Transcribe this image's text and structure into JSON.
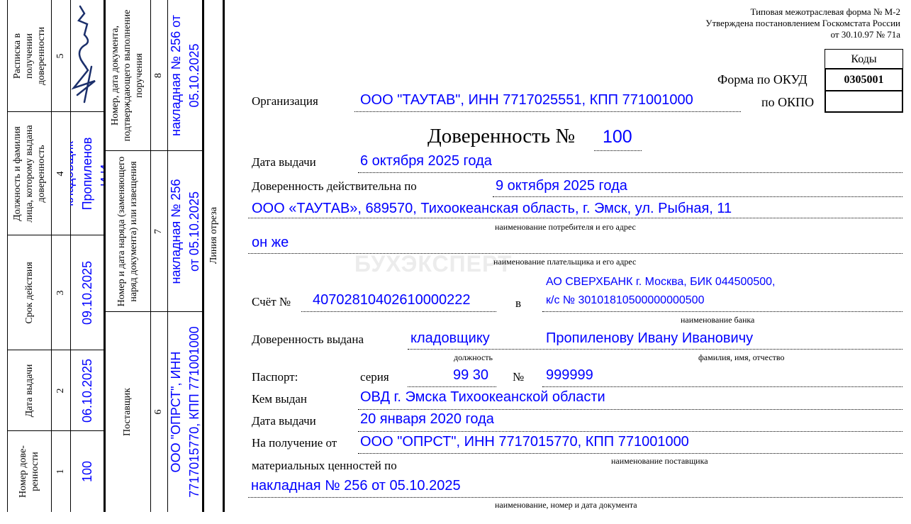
{
  "stub": {
    "col1": {
      "header": "Номер дове-ренности",
      "num": "1",
      "value": "100"
    },
    "col2": {
      "header": "Дата выдачи",
      "num": "2",
      "value": "06.10.2025"
    },
    "col3": {
      "header": "Срок действия",
      "num": "3",
      "value": "09.10.2025"
    },
    "col4": {
      "header": "Должность и фамилия лица, которому выдана доверенность",
      "num": "4",
      "value": "кладовщик Пропиленов И.И."
    },
    "col5": {
      "header": "Расписка в получении доверенности",
      "num": "5"
    },
    "col6": {
      "header": "Поставщик",
      "num": "6",
      "value": "ООО \"ОПРСТ\", ИНН 7717015770, КПП 771001000"
    },
    "col7": {
      "header": "Номер и дата наряда (заменяющего наряд документа) или извещения",
      "num": "7",
      "value": "накладная № 256 от 05.10.2025"
    },
    "col8": {
      "header": "Номер, дата документа, подтверждающего выполнение поручения",
      "num": "8",
      "value": "накладная № 256 от 05.10.2025"
    },
    "cut_line": "Линия отреза"
  },
  "header": {
    "form_line1": "Типовая межотраслевая форма № М-2",
    "form_line2": "Утверждена постановлением Госкомстата России",
    "form_line3": "от 30.10.97  № 71а",
    "codes_label": "Коды",
    "okud_label": "Форма по ОКУД",
    "okud_value": "0305001",
    "okpo_label": "по ОКПО",
    "okpo_value": ""
  },
  "watermark": "БУХЭКСПЕРТ",
  "form": {
    "org_label": "Организация",
    "org_value": "ООО \"ТАУТАВ\", ИНН 7717025551, КПП 771001000",
    "title": "Доверенность №",
    "number": "100",
    "issue_label": "Дата выдачи",
    "issue_value": "6 октября 2025 года",
    "valid_label": "Доверенность действительна по",
    "valid_value": "9 октября 2025 года",
    "consumer_value": "ООО «ТАУТАВ», 689570, Тихоокеанская область, г. Эмск, ул. Рыбная, 11",
    "consumer_caption": "наименование потребителя и его адрес",
    "payer_value": "он же",
    "payer_caption": "наименование плательщика и его адрес",
    "account_label": "Счёт №",
    "account_value": "40702810402610000222",
    "in_label": "в",
    "bank_line1": "АО СВЕРХБАНК г. Москва, БИК 044500500,",
    "bank_line2": "к/с № 30101810500000000500",
    "bank_caption": "наименование банка",
    "issued_to_label": "Доверенность выдана",
    "position_value": "кладовщику",
    "position_caption": "должность",
    "person_value": "Пропиленову Ивану Ивановичу",
    "person_caption": "фамилия, имя, отчество",
    "passport_label": "Паспорт:",
    "series_label": "серия",
    "series_value": "99 30",
    "no_label": "№",
    "passport_number": "999999",
    "issued_by_label": "Кем выдан",
    "issued_by_value": "ОВД г. Эмска Тихоокеанской области",
    "passport_date_label": "Дата выдачи",
    "passport_date_value": "20 января 2020 года",
    "receive_label": "На получение от",
    "supplier_value": "ООО \"ОПРСТ\", ИНН 7717015770, КПП 771001000",
    "supplier_caption": "наименование поставщика",
    "goods_label": "материальных ценностей по",
    "document_value": "накладная № 256 от 05.10.2025",
    "document_caption": "наименование, номер и дата документа"
  }
}
